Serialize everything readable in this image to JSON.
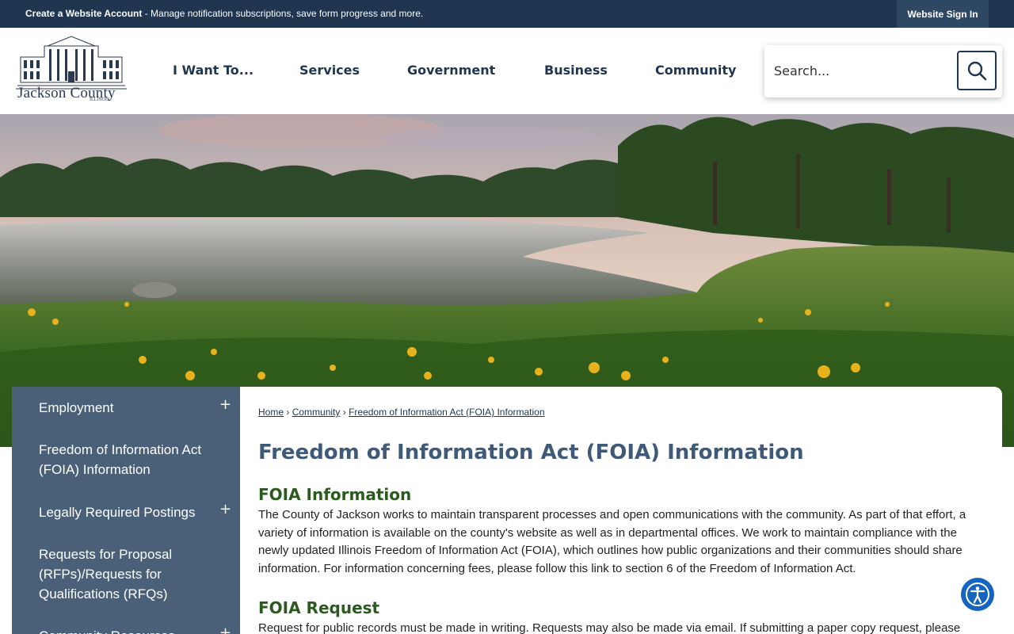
{
  "topbar": {
    "create_account": "Create a Website Account",
    "message": " - Manage notification subscriptions, save form progress and more.",
    "signin": "Website Sign In"
  },
  "logo": {
    "name": "Jackson County",
    "state": "ILLINOIS"
  },
  "nav": [
    "I Want To...",
    "Services",
    "Government",
    "Business",
    "Community"
  ],
  "search": {
    "placeholder": "Search..."
  },
  "sidebar": {
    "items": [
      {
        "label": "Employment",
        "expandable": true
      },
      {
        "label": "Freedom of Information Act (FOIA) Information",
        "expandable": false
      },
      {
        "label": "Legally Required Postings",
        "expandable": true
      },
      {
        "label": "Requests for Proposal (RFPs)/Requests for Qualifications (RFQs)",
        "expandable": false
      },
      {
        "label": "Community Resources",
        "expandable": true
      }
    ],
    "expand_symbol": "+"
  },
  "breadcrumb": {
    "items": [
      "Home",
      "Community",
      "Freedom of Information Act (FOIA) Information"
    ],
    "separator": "›"
  },
  "main": {
    "title": "Freedom of Information Act (FOIA) Information",
    "section1_heading": "FOIA Information",
    "section1_text": "The County of Jackson works to maintain transparent processes and open communications with the community. As part of that effort, a variety of information is available on the county's website as well as in departmental offices. We work to maintain compliance with the newly updated Illinois Freedom of Information Act (FOIA), which outlines how public organizations and their communities should share information. For information concerning fees, please follow this link to section 6 of the Freedom of Information Act.",
    "section2_heading": "FOIA Request",
    "section2_text": "Request for public records must be made in writing. Requests may also be made via email. If submitting a paper copy request, please"
  },
  "colors": {
    "topbar": "#1f3550",
    "nav_text": "#1f3550",
    "sidebar_bg": "#4a5f78",
    "title": "#3f5a78",
    "heading_green": "#2a5a1d",
    "accessibility": "#1565c0"
  }
}
